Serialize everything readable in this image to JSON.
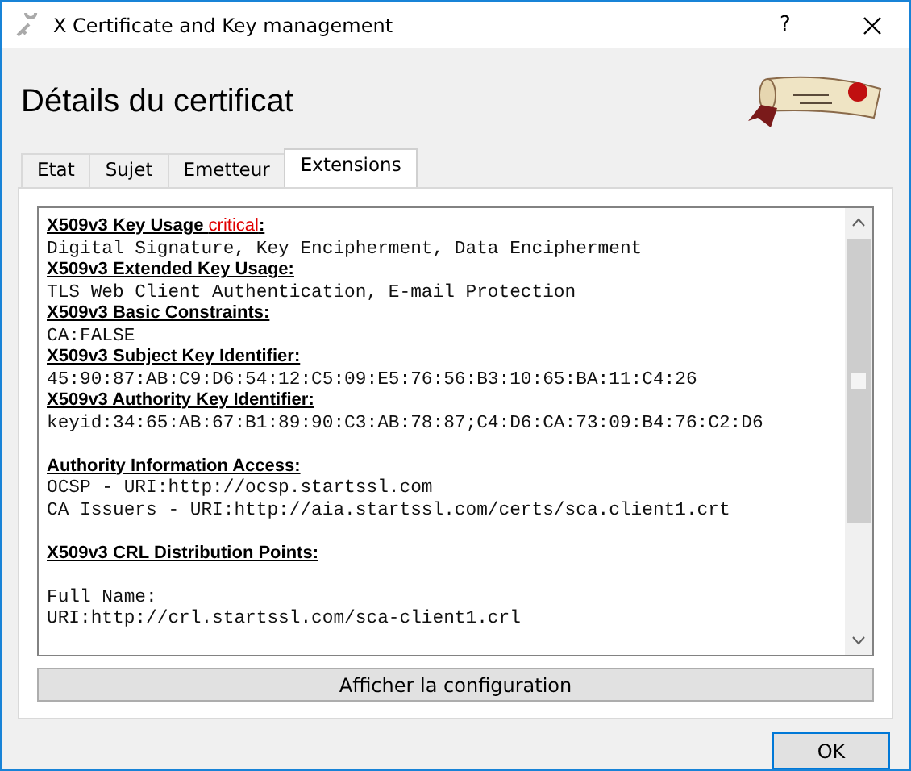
{
  "window": {
    "title": "X Certificate and Key management",
    "help": "?"
  },
  "heading": "Détails du certificat",
  "tabs": [
    {
      "label": "Etat",
      "selected": false
    },
    {
      "label": "Sujet",
      "selected": false
    },
    {
      "label": "Emetteur",
      "selected": false
    },
    {
      "label": "Extensions",
      "selected": true
    }
  ],
  "lines": [
    {
      "kind": "heading",
      "text": "X509v3 Key Usage ",
      "flag": "critical",
      "suffix": ":"
    },
    {
      "kind": "text",
      "text": "Digital Signature, Key Encipherment, Data Encipherment"
    },
    {
      "kind": "heading",
      "text": "X509v3 Extended Key Usage:"
    },
    {
      "kind": "text",
      "text": "TLS Web Client Authentication, E-mail Protection"
    },
    {
      "kind": "heading",
      "text": "X509v3 Basic Constraints:"
    },
    {
      "kind": "text",
      "text": "CA:FALSE"
    },
    {
      "kind": "heading",
      "text": "X509v3 Subject Key Identifier:"
    },
    {
      "kind": "text",
      "text": "45:90:87:AB:C9:D6:54:12:C5:09:E5:76:56:B3:10:65:BA:11:C4:26"
    },
    {
      "kind": "heading",
      "text": "X509v3 Authority Key Identifier:"
    },
    {
      "kind": "text",
      "text": "keyid:34:65:AB:67:B1:89:90:C3:AB:78:87;C4:D6:CA:73:09:B4:76:C2:D6"
    },
    {
      "kind": "blank"
    },
    {
      "kind": "heading",
      "text": "Authority Information Access:"
    },
    {
      "kind": "text",
      "text": "OCSP - URI:http://ocsp.startssl.com"
    },
    {
      "kind": "text",
      "text": "CA Issuers - URI:http://aia.startssl.com/certs/sca.client1.crt"
    },
    {
      "kind": "blank"
    },
    {
      "kind": "heading",
      "text": "X509v3 CRL Distribution Points:"
    },
    {
      "kind": "blank"
    },
    {
      "kind": "text",
      "text": "Full Name:"
    },
    {
      "kind": "text",
      "text": "URI:http://crl.startssl.com/sca-client1.crl"
    }
  ],
  "config_button": "Afficher la configuration",
  "ok_button": "OK"
}
